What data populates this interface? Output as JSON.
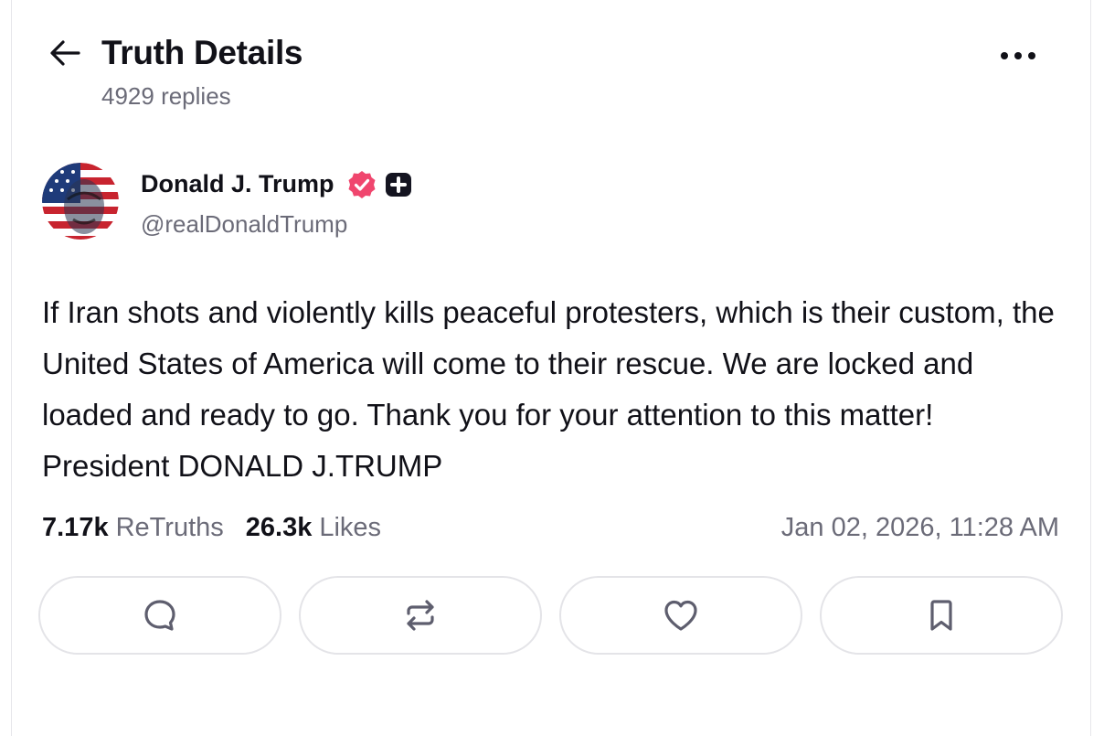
{
  "header": {
    "title": "Truth Details",
    "replies": "4929 replies",
    "back_icon": "arrow-left-icon",
    "more_icon": "more-horizontal-icon"
  },
  "author": {
    "name": "Donald J. Trump",
    "handle": "@realDonaldTrump",
    "verified_icon": "verified-badge-icon",
    "plus_icon": "plus-badge-icon",
    "verified_color": "#f0466e"
  },
  "post": {
    "text": "If Iran shots and violently kills peaceful protesters, which is their custom, the United States of America will come to their rescue. We are locked and loaded and ready to go. Thank you for your attention to this matter! President DONALD J.TRUMP"
  },
  "stats": {
    "retruths_count": "7.17k",
    "retruths_label": "ReTruths",
    "likes_count": "26.3k",
    "likes_label": "Likes",
    "timestamp": "Jan 02, 2026, 11:28 AM"
  },
  "actions": [
    {
      "name": "reply",
      "icon": "comment-icon"
    },
    {
      "name": "retruth",
      "icon": "repost-icon"
    },
    {
      "name": "like",
      "icon": "heart-icon"
    },
    {
      "name": "bookmark",
      "icon": "bookmark-icon"
    }
  ]
}
